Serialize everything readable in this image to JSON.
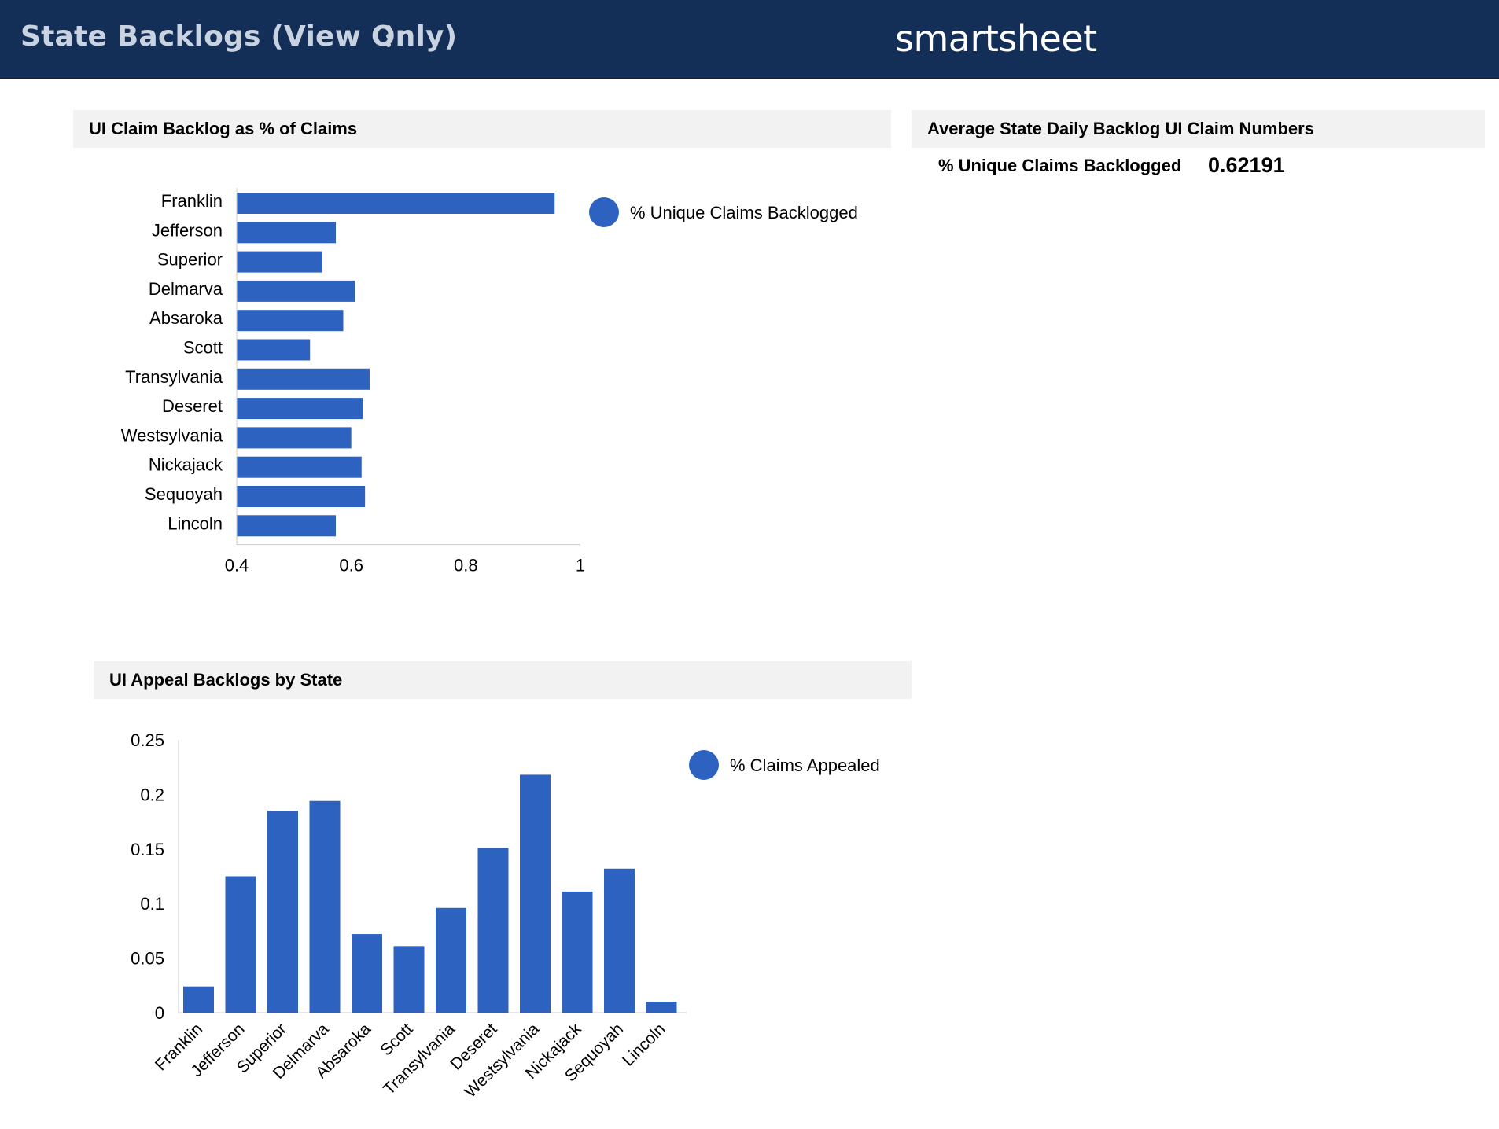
{
  "header": {
    "title": "State Backlogs (View Only)",
    "brand": "smartsheet",
    "background": "#132e57"
  },
  "widgets": {
    "backlog_title": "UI Claim Backlog as % of Claims",
    "average_title": "Average State Daily Backlog UI Claim Numbers",
    "appeal_title": "UI Appeal Backlogs by State"
  },
  "metric": {
    "label": "% Unique Claims Backlogged",
    "value": "0.62191"
  },
  "colors": {
    "bar": "#2d62c0"
  },
  "chart_data": [
    {
      "type": "bar",
      "orientation": "horizontal",
      "title": "UI Claim Backlog as % of Claims",
      "categories": [
        "Franklin",
        "Jefferson",
        "Superior",
        "Delmarva",
        "Absaroka",
        "Scott",
        "Transylvania",
        "Deseret",
        "Westsylvania",
        "Nickajack",
        "Sequoyah",
        "Lincoln"
      ],
      "series": [
        {
          "name": "% Unique Claims Backlogged",
          "values": [
            0.955,
            0.573,
            0.549,
            0.606,
            0.586,
            0.528,
            0.632,
            0.62,
            0.6,
            0.618,
            0.624,
            0.573
          ]
        }
      ],
      "xlim": [
        0.4,
        1
      ],
      "xticks": [
        "0.4",
        "0.6",
        "0.8",
        "1"
      ],
      "legend": "right"
    },
    {
      "type": "bar",
      "orientation": "vertical",
      "title": "UI Appeal Backlogs by State",
      "categories": [
        "Franklin",
        "Jefferson",
        "Superior",
        "Delmarva",
        "Absaroka",
        "Scott",
        "Transylvania",
        "Deseret",
        "Westsylvania",
        "Nickajack",
        "Sequoyah",
        "Lincoln"
      ],
      "series": [
        {
          "name": "% Claims Appealed",
          "values": [
            0.024,
            0.125,
            0.185,
            0.194,
            0.072,
            0.061,
            0.096,
            0.151,
            0.218,
            0.111,
            0.132,
            0.01
          ]
        }
      ],
      "ylim": [
        0,
        0.25
      ],
      "yticks": [
        "0",
        "0.05",
        "0.1",
        "0.15",
        "0.2",
        "0.25"
      ],
      "legend": "top-right"
    }
  ]
}
